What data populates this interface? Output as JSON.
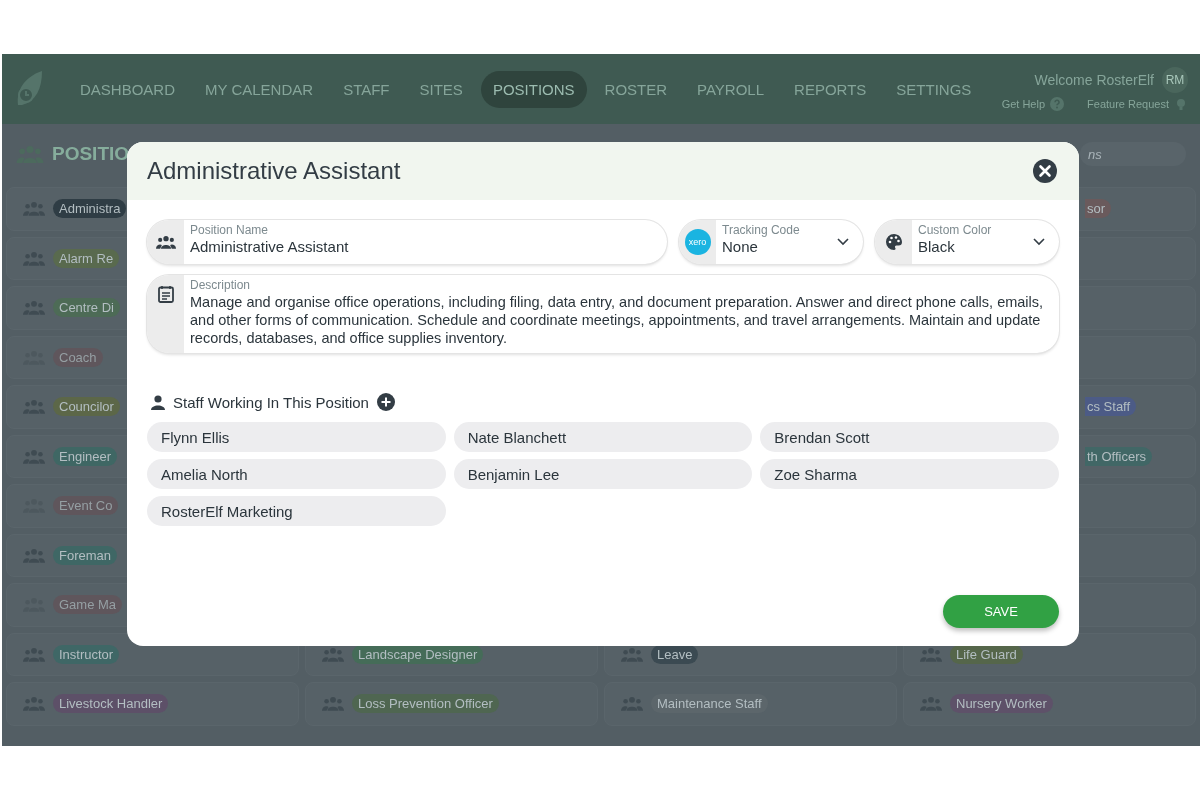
{
  "nav": {
    "items": [
      {
        "label": "DASHBOARD",
        "selected": false
      },
      {
        "label": "MY CALENDAR",
        "selected": false
      },
      {
        "label": "STAFF",
        "selected": false
      },
      {
        "label": "SITES",
        "selected": false
      },
      {
        "label": "POSITIONS",
        "selected": true
      },
      {
        "label": "ROSTER",
        "selected": false
      },
      {
        "label": "PAYROLL",
        "selected": false
      },
      {
        "label": "REPORTS",
        "selected": false
      },
      {
        "label": "SETTINGS",
        "selected": false
      }
    ],
    "welcome": "Welcome RosterElf",
    "avatar": "RM",
    "help": "Get Help",
    "feature": "Feature Request"
  },
  "page": {
    "title": "POSITIO",
    "search_placeholder": "ns",
    "grid": [
      [
        {
          "label": "Administra",
          "color": "#2f3d45",
          "inactive": false,
          "kind": "tag"
        },
        {
          "label": "sor",
          "color": "#6a5a5c",
          "inactive": false,
          "kind": "fragment"
        }
      ],
      [
        {
          "label": "Alarm Re",
          "color": "#596a4e",
          "inactive": false,
          "kind": "tag"
        }
      ],
      [
        {
          "label": "Centre Di",
          "color": "#4d6b56",
          "inactive": false,
          "kind": "tag"
        }
      ],
      [
        {
          "label": "Coach",
          "color": "#5f565c",
          "inactive": true,
          "kind": "tag"
        }
      ],
      [
        {
          "label": "Councilor",
          "color": "#5c6748",
          "inactive": false,
          "kind": "tag"
        },
        {
          "label": "cs Staff",
          "color": "#4c5b86",
          "inactive": false,
          "kind": "fragment"
        }
      ],
      [
        {
          "label": "Engineer",
          "color": "#3f6764",
          "inactive": false,
          "kind": "tag"
        },
        {
          "label": "th Officers",
          "color": "#416766",
          "inactive": false,
          "kind": "fragment"
        }
      ],
      [
        {
          "label": "Event Co",
          "color": "#5f565c",
          "inactive": true,
          "kind": "tag"
        }
      ],
      [
        {
          "label": "Foreman",
          "color": "#3f6765",
          "inactive": false,
          "kind": "tag"
        }
      ],
      [
        {
          "label": "Game Ma",
          "color": "#5f565c",
          "inactive": true,
          "kind": "tag"
        }
      ],
      [
        {
          "label": "Instructor",
          "color": "#3f6766",
          "inactive": false,
          "kind": "tag"
        },
        {
          "label": "Landscape Designer",
          "color": "#456c58",
          "inactive": false,
          "kind": "tag"
        },
        {
          "label": "Leave",
          "color": "#3b4a52",
          "inactive": false,
          "kind": "tag"
        },
        {
          "label": "Life Guard",
          "color": "#55664a",
          "inactive": false,
          "kind": "tag"
        }
      ],
      [
        {
          "label": "Livestock Handler",
          "color": "#5d5068",
          "inactive": false,
          "kind": "tag"
        },
        {
          "label": "Loss Prevention Officer",
          "color": "#4f6651",
          "inactive": false,
          "kind": "tag"
        },
        {
          "label": "Maintenance Staff",
          "color": "#5c666b",
          "inactive": false,
          "kind": "tag"
        },
        {
          "label": "Nursery Worker",
          "color": "#5e5169",
          "inactive": false,
          "kind": "tag"
        }
      ]
    ]
  },
  "modal": {
    "title": "Administrative Assistant",
    "position_name": {
      "label": "Position Name",
      "value": "Administrative Assistant"
    },
    "tracking_code": {
      "label": "Tracking Code",
      "value": "None",
      "logo": "xero"
    },
    "custom_color": {
      "label": "Custom Color",
      "value": "Black"
    },
    "description": {
      "label": "Description",
      "value": "Manage and organise office operations, including filing, data entry, and document preparation. Answer and direct phone calls, emails, and other forms of communication. Schedule and coordinate meetings, appointments, and travel arrangements. Maintain and update records, databases, and office supplies inventory."
    },
    "staff_heading": "Staff Working In This Position",
    "staff": [
      "Flynn Ellis",
      "Nate Blanchett",
      "Brendan Scott",
      "Amelia North",
      "Benjamin Lee",
      "Zoe Sharma",
      "RosterElf Marketing"
    ],
    "save": "SAVE"
  }
}
